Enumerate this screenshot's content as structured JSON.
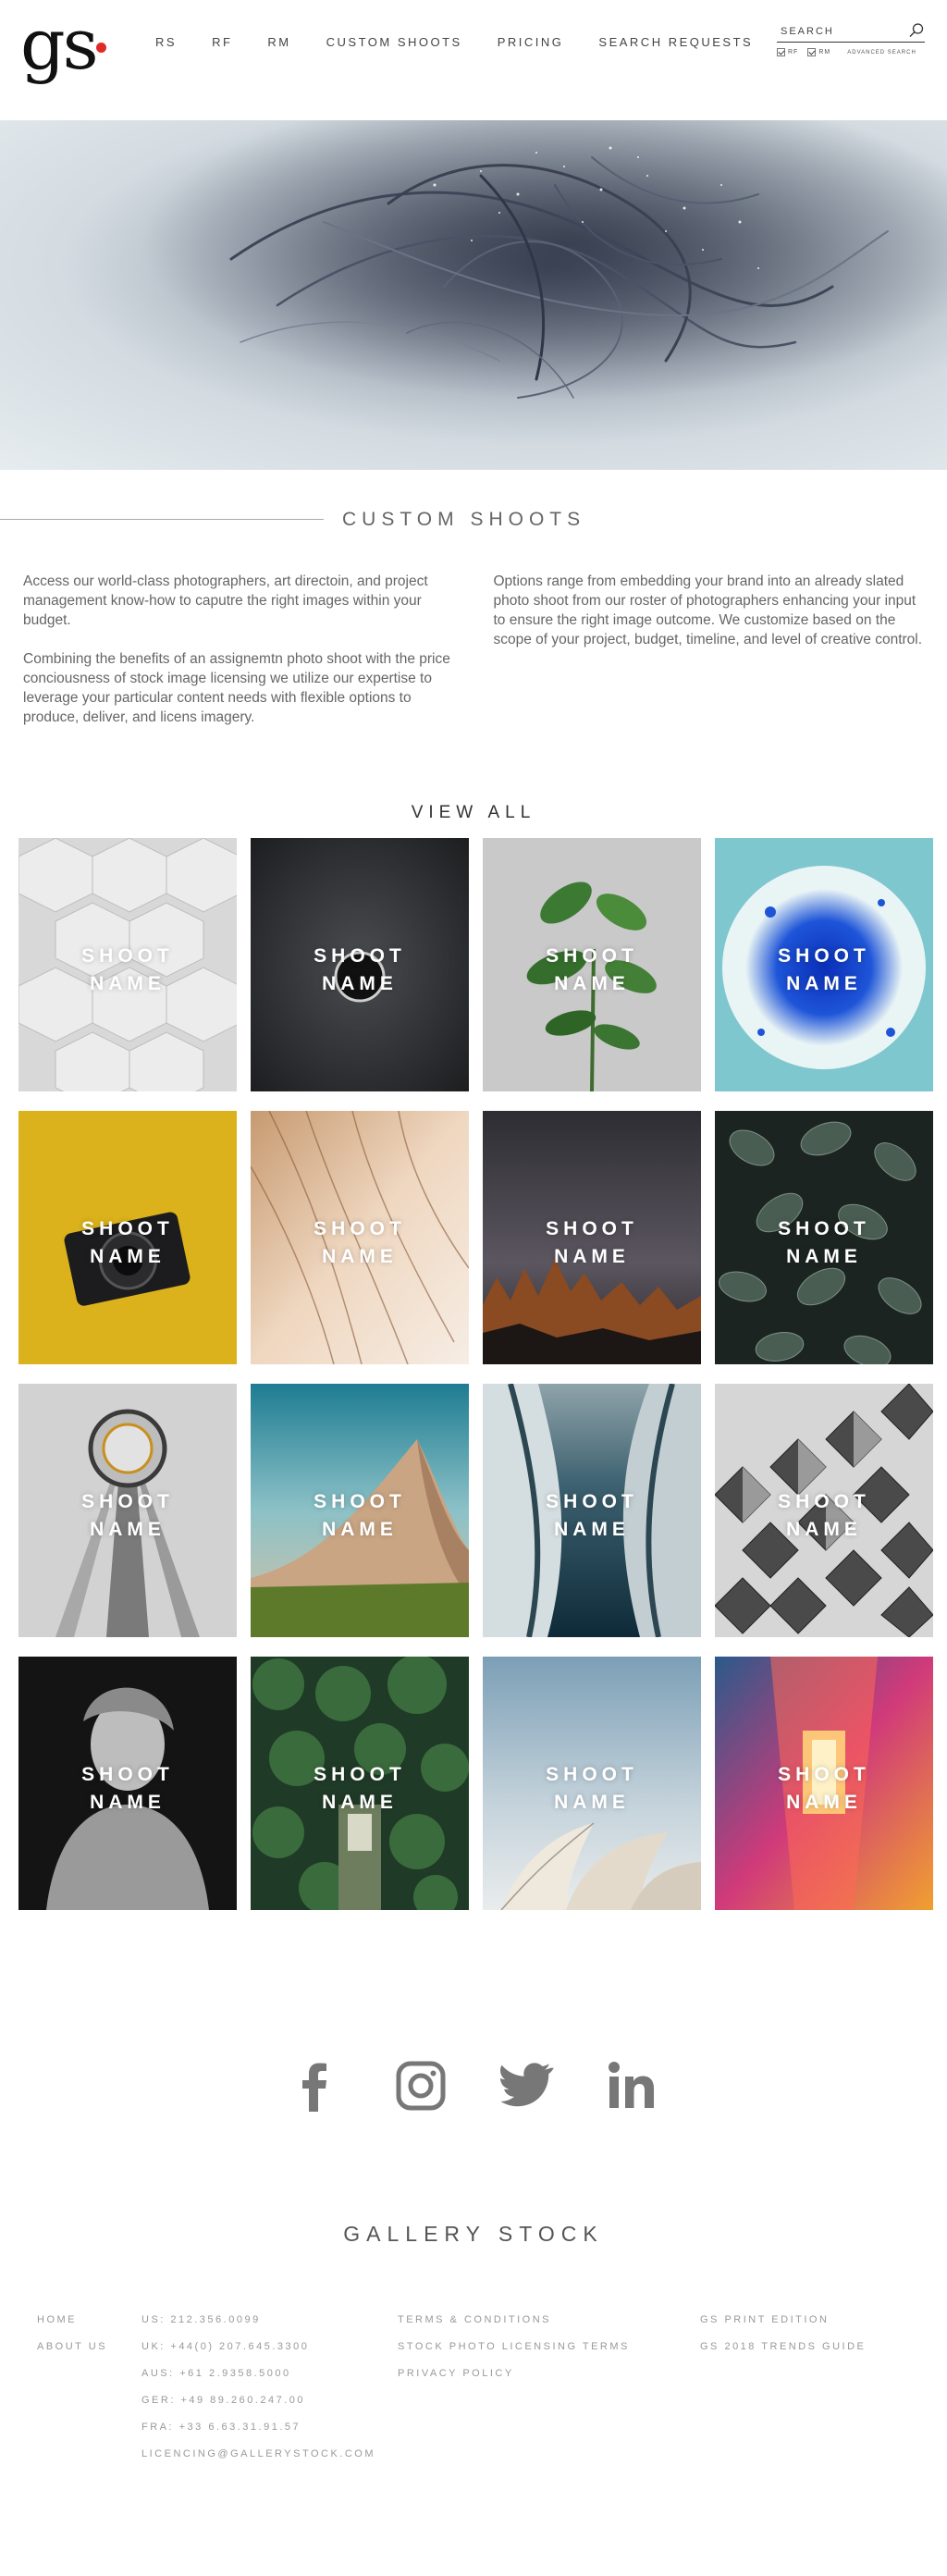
{
  "header": {
    "logo_text": "gs",
    "nav": [
      {
        "label": "RS"
      },
      {
        "label": "RF"
      },
      {
        "label": "RM"
      },
      {
        "label": "CUSTOM SHOOTS"
      },
      {
        "label": "PRICING"
      },
      {
        "label": "SEARCH REQUESTS"
      }
    ],
    "search": {
      "placeholder": "SEARCH",
      "option_rf": "RF",
      "option_rm": "RM",
      "advanced": "ADVANCED SEARCH"
    }
  },
  "section": {
    "title": "CUSTOM SHOOTS"
  },
  "intro": {
    "left": [
      "Access our world-class photographers, art directoin, and project management know-how to caputre the right images within your budget.",
      "Combining the benefits of an assignemtn photo shoot with the price conciousness of stock image licensing we utilize our expertise to leverage your particular content needs with flexible options to produce, deliver, and licens imagery."
    ],
    "right": [
      "Options range from embedding your brand into an already slated photo shoot from our roster of photographers enhancing your input to ensure the right image outcome. We customize based on the scope of your project, budget, timeline, and level of creative control."
    ]
  },
  "view_all": "VIEW ALL",
  "shoots": [
    {
      "line1": "SHOOT",
      "line2": "NAME"
    },
    {
      "line1": "SHOOT",
      "line2": "NAME"
    },
    {
      "line1": "SHOOT",
      "line2": "NAME"
    },
    {
      "line1": "SHOOT",
      "line2": "NAME"
    },
    {
      "line1": "SHOOT",
      "line2": "NAME"
    },
    {
      "line1": "SHOOT",
      "line2": "NAME"
    },
    {
      "line1": "SHOOT",
      "line2": "NAME"
    },
    {
      "line1": "SHOOT",
      "line2": "NAME"
    },
    {
      "line1": "SHOOT",
      "line2": "NAME"
    },
    {
      "line1": "SHOOT",
      "line2": "NAME"
    },
    {
      "line1": "SHOOT",
      "line2": "NAME"
    },
    {
      "line1": "SHOOT",
      "line2": "NAME"
    },
    {
      "line1": "SHOOT",
      "line2": "NAME"
    },
    {
      "line1": "SHOOT",
      "line2": "NAME"
    },
    {
      "line1": "SHOOT",
      "line2": "NAME"
    },
    {
      "line1": "SHOOT",
      "line2": "NAME"
    }
  ],
  "social": [
    "facebook-icon",
    "instagram-icon",
    "twitter-icon",
    "linkedin-icon"
  ],
  "footer": {
    "brand": "GALLERY STOCK",
    "links_main": [
      "HOME",
      "ABOUT US"
    ],
    "contacts": [
      "US: 212.356.0099",
      "UK: +44(0) 207.645.3300",
      "AUS: +61 2.9358.5000",
      "GER: +49 89.260.247.00",
      "FRA: +33 6.63.31.91.57",
      "LICENCING@GALLERYSTOCK.COM"
    ],
    "links_legal": [
      "TERMS & CONDITIONS",
      "STOCK PHOTO LICENSING TERMS",
      "PRIVACY POLICY"
    ],
    "links_print": [
      "GS PRINT EDITION",
      "GS 2018 TRENDS GUIDE"
    ]
  },
  "colors": {
    "logo_dot": "#e02a2a",
    "text": "#555555",
    "footer_text": "#999999"
  }
}
